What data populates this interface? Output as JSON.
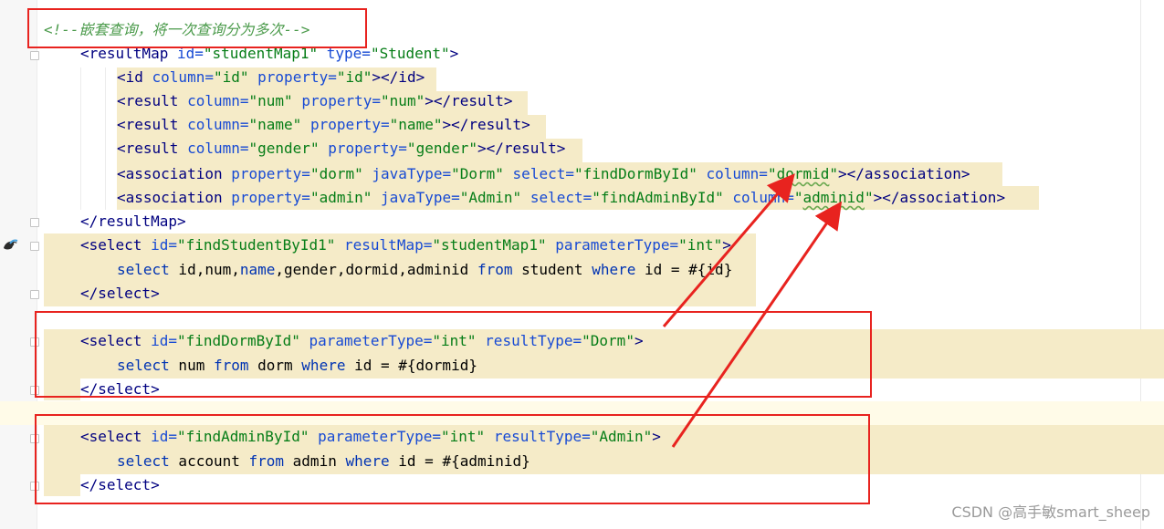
{
  "code": {
    "comment": "<!--嵌套查询，将一次查询分为多次-->",
    "result_map_open": {
      "id": "studentMap1",
      "type": "Student"
    },
    "id_line": {
      "column": "id",
      "property": "id"
    },
    "result_lines": [
      {
        "column": "num",
        "property": "num"
      },
      {
        "column": "name",
        "property": "name"
      },
      {
        "column": "gender",
        "property": "gender"
      }
    ],
    "associations": [
      {
        "property": "dorm",
        "javaType": "Dorm",
        "select": "findDormById",
        "column": "dormid"
      },
      {
        "property": "admin",
        "javaType": "Admin",
        "select": "findAdminById",
        "column": "adminid"
      }
    ],
    "select1": {
      "id": "findStudentById1",
      "resultMap": "studentMap1",
      "parameterType": "int",
      "sql": "select id,num,name,gender,dormid,adminid from student where id = #{id}"
    },
    "select2": {
      "id": "findDormById",
      "parameterType": "int",
      "resultType": "Dorm",
      "sql": "select num from dorm where id = #{dormid}"
    },
    "select3": {
      "id": "findAdminById",
      "parameterType": "int",
      "resultType": "Admin",
      "sql": "select account from admin where id = #{adminid}"
    }
  },
  "watermark": "CSDN @高手敏smart_sheep",
  "colors": {
    "annotation": "#e8231f",
    "highlight": "#f5ebc8"
  }
}
